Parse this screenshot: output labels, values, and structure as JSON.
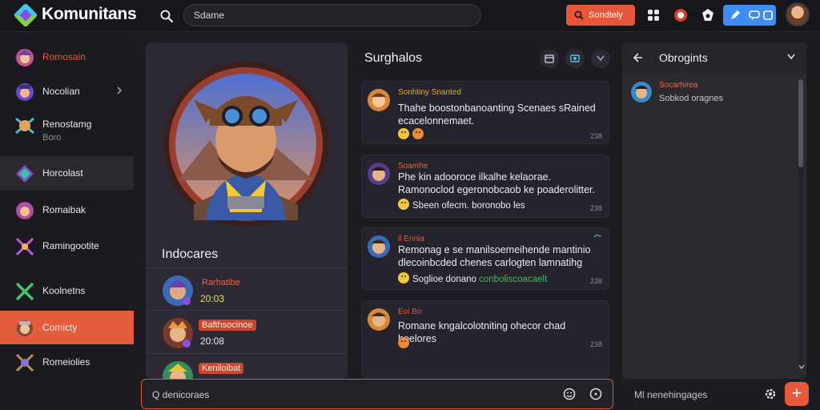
{
  "header": {
    "app_title": "Komunitans",
    "search_placeholder": "Sdame",
    "cta_label": "Sondtely"
  },
  "sidebar": {
    "items": [
      {
        "label": "Romosain",
        "accent": "#e8583c"
      },
      {
        "label": "Nocolian"
      },
      {
        "label": "Renostamg",
        "sub": "Boro"
      },
      {
        "label": "Horcolast"
      },
      {
        "label": "Romaibak"
      },
      {
        "label": "Ramingootite"
      },
      {
        "label": "Koolnetns"
      },
      {
        "label": "Comicty"
      },
      {
        "label": "Romeiolies"
      }
    ]
  },
  "profile": {
    "heading": "Indocares",
    "members": [
      {
        "name": "Rarhatibe",
        "time": "20:03"
      },
      {
        "name": "Bafthsocinoe",
        "time": "20:08"
      },
      {
        "name": "Keniloibat"
      }
    ]
  },
  "chat": {
    "title": "Surghalos",
    "messages": [
      {
        "author": "Sonhtiny  Snanted",
        "body": "Thahe boostonbanoanting  Scenaes  sRained ecacelonnemaet.",
        "reaction": "",
        "time": "238"
      },
      {
        "author": "Soamhe",
        "body": "Phe kin adooroce  ilkalhe kelaorae. Ramonoclod egeronobcaob  ke poaderolitter.",
        "reaction": "Sbeen  ofecm.  boronobo les",
        "time": "238"
      },
      {
        "author": "ll  Ennia",
        "body": "Remonag e se manilsoemeihende  mantinio dlecoinbcded  chenes  carlogten lamnatihg",
        "reaction": "Soglioe  donano",
        "reaction_extra": "conboliscoacaelt",
        "time": "238"
      },
      {
        "author": "Eoi  Bo",
        "body": "Romane kngalcolotniting ohecor  chad hoelores",
        "reaction": "",
        "time": "238"
      }
    ]
  },
  "right_panel": {
    "title": "Obrogints",
    "entries": [
      {
        "name": "Socarhirea",
        "sub": "Sobkod oragnes"
      }
    ]
  },
  "composer": {
    "placeholder": "Q  denicoraes"
  },
  "right_input": {
    "placeholder": "Ml  nenehingages"
  },
  "colors": {
    "accent": "#e55a3a",
    "blue": "#3f8cf2"
  }
}
